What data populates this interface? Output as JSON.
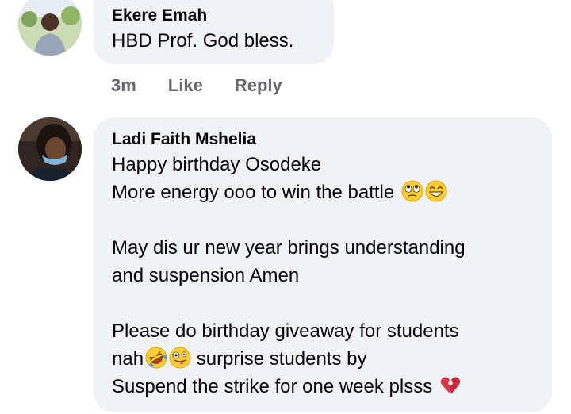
{
  "comments": [
    {
      "author": "Ekere Emah",
      "lines": [
        "HBD Prof. God bless."
      ],
      "time": "3m",
      "actions": [
        "Like",
        "Reply"
      ]
    },
    {
      "author": "Ladi Faith Mshelia",
      "lines": [
        "Happy birthday Osodeke",
        "More energy ooo to win the battle",
        "",
        "May dis ur new year brings understanding",
        "and suspension Amen",
        "",
        "Please do birthday giveaway for students",
        "nah",
        "surprise students by",
        "Suspend the strike for one week plsss"
      ]
    }
  ],
  "icons": {
    "avatar_1": "avatar-man-outdoor",
    "avatar_2": "avatar-woman-mask",
    "emoji_1": "face-with-rolling-eyes",
    "emoji_2": "grinning-face-with-smiling-eyes",
    "emoji_3": "rolling-on-floor-laughing",
    "emoji_4": "zany-face",
    "emoji_5": "broken-heart"
  },
  "colors": {
    "bubble": "#f0f2f5",
    "text": "#050505",
    "secondary": "#65676b"
  }
}
